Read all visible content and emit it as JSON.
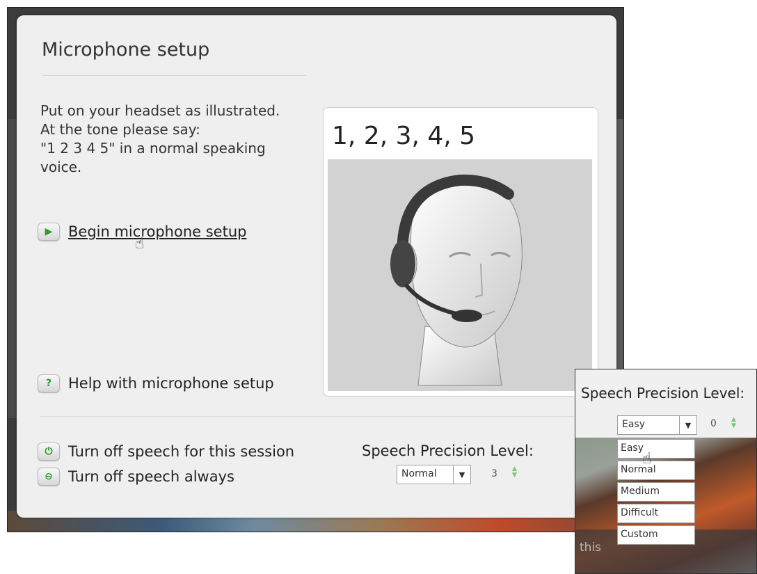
{
  "dialog": {
    "title": "Microphone setup",
    "instructions": [
      "Put on your headset as illustrated.",
      "At the tone please say:",
      "\"1 2 3 4 5\" in a normal speaking",
      "voice."
    ],
    "begin_label": "Begin microphone setup",
    "help_label": "Help with microphone setup",
    "help_icon": "?",
    "illustration_text": "1, 2, 3, 4, 5",
    "turn_off_session_label": "Turn off speech for this session",
    "turn_off_always_label": "Turn off speech always",
    "precision_label": "Speech Precision Level:",
    "precision_value": "Normal",
    "precision_number": "3"
  },
  "inset": {
    "precision_label": "Speech Precision Level:",
    "precision_value": "Easy",
    "precision_number": "0",
    "options": [
      "Easy",
      "Normal",
      "Medium",
      "Difficult",
      "Custom"
    ],
    "caption": "this"
  },
  "colors": {
    "accent_green": "#2a9a2a",
    "dialog_bg": "#efefef"
  }
}
